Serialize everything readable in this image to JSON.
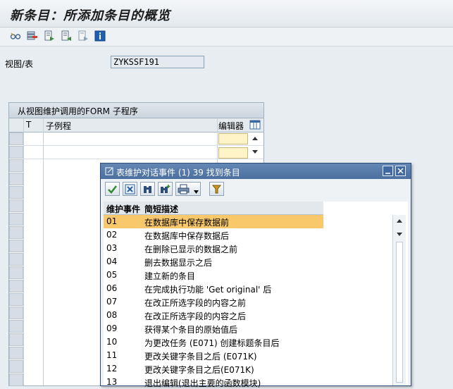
{
  "window": {
    "title": "新条目：所添加条目的概览"
  },
  "toolbar": {
    "icons": [
      "glasses-icon",
      "delete-row-icon",
      "export-icon",
      "copy-icon",
      "undo-icon",
      "info-icon"
    ]
  },
  "form": {
    "view_label": "视图/表",
    "view_value": "ZYKSSF191"
  },
  "panel": {
    "title": "从视图维护调用的FORM 子程序",
    "columns": [
      "T",
      "子例程",
      "编辑器"
    ]
  },
  "dialog": {
    "title": "表维护对话事件 (1)  39 找到条目",
    "columns": [
      "维护事件",
      "简短描述"
    ],
    "rows": [
      {
        "code": "01",
        "desc": "在数据库中保存数据前"
      },
      {
        "code": "02",
        "desc": "在数据库中保存数据后"
      },
      {
        "code": "03",
        "desc": "在删除已显示的数据之前"
      },
      {
        "code": "04",
        "desc": "删去数据显示之后"
      },
      {
        "code": "05",
        "desc": "建立新的条目"
      },
      {
        "code": "06",
        "desc": "在完成执行功能 'Get original' 后"
      },
      {
        "code": "07",
        "desc": "在改正所选字段的内容之前"
      },
      {
        "code": "08",
        "desc": "在改正所选字段的内容之后"
      },
      {
        "code": "09",
        "desc": "获得某个条目的原始值后"
      },
      {
        "code": "10",
        "desc": "为更改任务 (E071) 创建标题条目后"
      },
      {
        "code": "11",
        "desc": "更改关键字条目之后 (E071K)"
      },
      {
        "code": "12",
        "desc": "更改关键字条目之后(E071K)"
      },
      {
        "code": "13",
        "desc": "退出编辑(退出主要的函数模块)"
      }
    ],
    "selected_row": "01"
  },
  "colors": {
    "selected_row": "#f8c86a",
    "dialog_title": "#4b6f9f",
    "editor_cell": "#fff3c8"
  }
}
